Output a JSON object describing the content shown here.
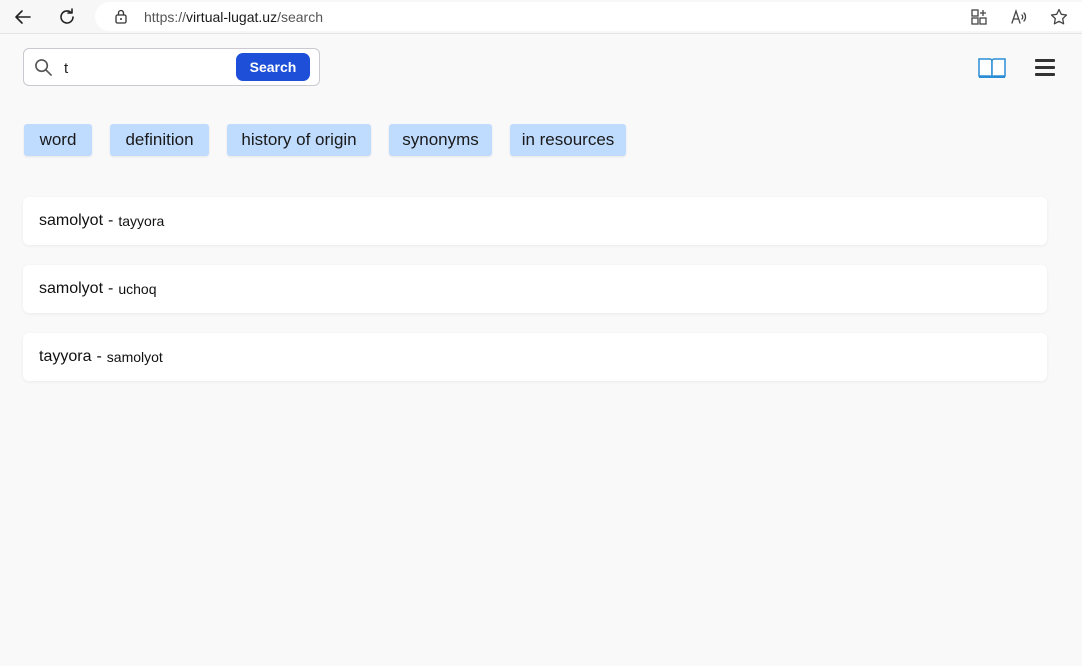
{
  "browser": {
    "url_scheme": "https://",
    "url_host": "virtual-lugat.uz",
    "url_path": "/search"
  },
  "search": {
    "value": "t",
    "button_label": "Search"
  },
  "filters": [
    "word",
    "definition",
    "history of origin",
    "synonyms",
    "in resources"
  ],
  "results": [
    {
      "word": "samolyot",
      "sep": "-",
      "synonym": "tayyora"
    },
    {
      "word": "samolyot",
      "sep": "-",
      "synonym": "uchoq"
    },
    {
      "word": "tayyora",
      "sep": "-",
      "synonym": "samolyot"
    }
  ],
  "colors": {
    "accent": "#1d4fd8",
    "chip": "#bfdbfe",
    "background": "#f9f9fa"
  }
}
